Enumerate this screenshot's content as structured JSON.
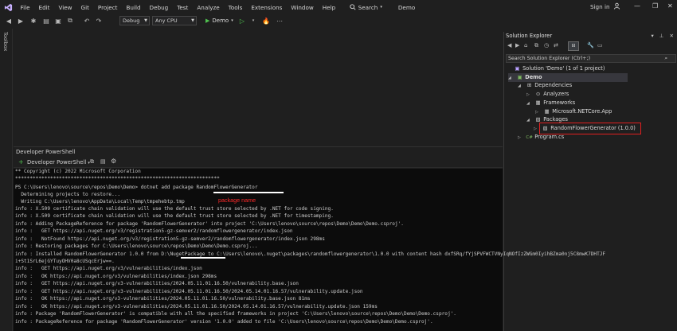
{
  "menubar": {
    "items": [
      "File",
      "Edit",
      "View",
      "Git",
      "Project",
      "Build",
      "Debug",
      "Test",
      "Analyze",
      "Tools",
      "Extensions",
      "Window",
      "Help"
    ],
    "search_label": "Search",
    "solution_title": "Demo",
    "signin": "Sign in"
  },
  "toolbar": {
    "config": "Debug",
    "platform": "Any CPU",
    "run_target": "Demo"
  },
  "toolbox": {
    "label": "Toolbox"
  },
  "solution_explorer": {
    "title": "Solution Explorer",
    "search_placeholder": "Search Solution Explorer (Ctrl+;)",
    "tree": [
      {
        "label": "Solution 'Demo' (1 of 1 project)",
        "icon": "solution-icon"
      },
      {
        "label": "Demo",
        "icon": "csharp-project-icon"
      },
      {
        "label": "Dependencies",
        "icon": "dependencies-icon"
      },
      {
        "label": "Analyzers",
        "icon": "analyzers-icon"
      },
      {
        "label": "Frameworks",
        "icon": "frameworks-icon"
      },
      {
        "label": "Microsoft.NETCore.App",
        "icon": "framework-icon"
      },
      {
        "label": "Packages",
        "icon": "packages-icon"
      },
      {
        "label": "RandomFlowerGenerator (1.0.0)",
        "icon": "package-icon"
      },
      {
        "label": "Program.cs",
        "icon": "csharp-file-icon"
      }
    ],
    "accent": "#e02020"
  },
  "powershell": {
    "tab_title": "Developer PowerShell",
    "dropdown": "Developer PowerShell",
    "annotation": "package name",
    "lines": [
      "** Copyright (c) 2022 Microsoft Corporation",
      "**********************************************************************",
      "PS C:\\Users\\lenovo\\source\\repos\\Demo\\Demo> dotnet add package RandomFlowerGenerator",
      "  Determining projects to restore...",
      "  Writing C:\\Users\\lenovo\\AppData\\Local\\Temp\\tmpehebtp.tmp",
      "info : X.509 certificate chain validation will use the default trust store selected by .NET for code signing.",
      "info : X.509 certificate chain validation will use the default trust store selected by .NET for timestamping.",
      "info : Adding PackageReference for package 'RandomFlowerGenerator' into project 'C:\\Users\\lenovo\\source\\repos\\Demo\\Demo\\Demo.csproj'.",
      "info :   GET https://api.nuget.org/v3/registration5-gz-semver2/randomflowergenerator/index.json",
      "info :   NotFound https://api.nuget.org/v3/registration5-gz-semver2/randomflowergenerator/index.json 298ms",
      "info : Restoring packages for C:\\Users\\lenovo\\source\\repos\\Demo\\Demo\\Demo.csproj...",
      "info : Installed RandomFlowerGenerator 1.0.0 from D:\\NugetPackage to C:\\Users\\lenovo\\.nuget\\packages\\randomflowergenerator\\1.0.0 with content hash dxfSRq/fYjSPVFWCTVNyIqNOfIzZWGm0IyihBZma0nj5C8mwK7DHTJF",
      "i+St1SrL6ejGYTuyOHV0a8cUSqcErjw==.",
      "info :   GET https://api.nuget.org/v3/vulnerabilities/index.json",
      "info :   OK https://api.nuget.org/v3/vulnerabilities/index.json 298ms",
      "info :   GET https://api.nuget.org/v3-vulnerabilities/2024.05.11.01.16.50/vulnerability.base.json",
      "info :   GET https://api.nuget.org/v3-vulnerabilities/2024.05.11.01.16.50/2024.05.14.01.16.57/vulnerability.update.json",
      "info :   OK https://api.nuget.org/v3-vulnerabilities/2024.05.11.01.16.50/vulnerability.base.json 81ms",
      "info :   OK https://api.nuget.org/v3-vulnerabilities/2024.05.11.01.16.50/2024.05.14.01.16.57/vulnerability.update.json 159ms",
      "info : Package 'RandomFlowerGenerator' is compatible with all the specified frameworks in project 'C:\\Users\\lenovo\\source\\repos\\Demo\\Demo\\Demo.csproj'.",
      "info : PackageReference for package 'RandomFlowerGenerator' version '1.0.0' added to file 'C:\\Users\\lenovo\\source\\repos\\Demo\\Demo\\Demo.csproj'."
    ]
  }
}
